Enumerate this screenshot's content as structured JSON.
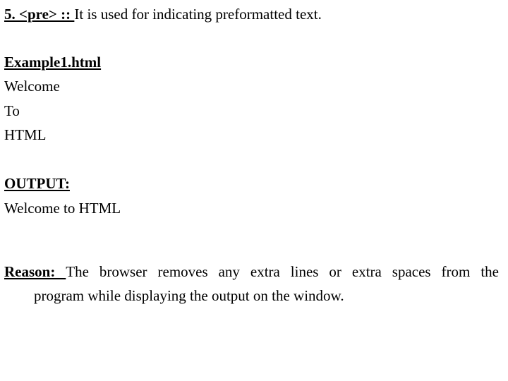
{
  "slide": {
    "background_color": "#ffffff",
    "text_color": "#000000",
    "heading": {
      "label": "5. <pre> :: ",
      "description": "It is used for indicating preformatted text."
    },
    "code_example": {
      "title": "Example1.html",
      "lines": [
        "Welcome",
        "To",
        "HTML"
      ]
    },
    "output": {
      "title": "OUTPUT:",
      "lines": [
        "Welcome to HTML"
      ]
    },
    "reason": {
      "label": "Reason: ",
      "text_line_1": "The browser removes any extra lines or extra spaces from the",
      "text_line_2": "program while displaying the output on the window."
    }
  }
}
